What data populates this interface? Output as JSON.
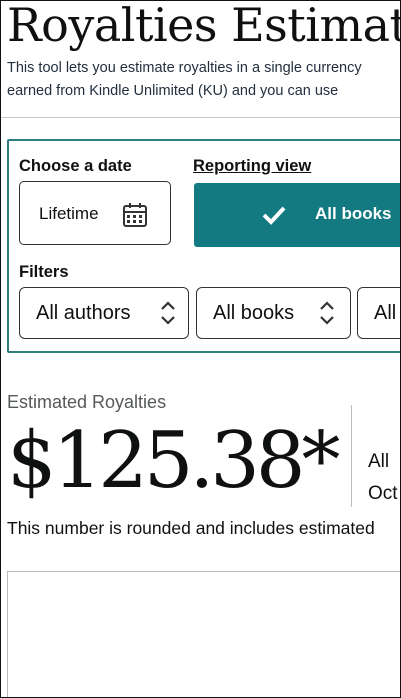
{
  "page": {
    "title": "Royalties Estimator",
    "intro_line1": "This tool lets you estimate royalties in a single currency",
    "intro_line2": "earned from Kindle Unlimited (KU) and you can use"
  },
  "controls": {
    "date_label": "Choose a date",
    "date_value": "Lifetime",
    "view_label": "Reporting view",
    "view_button": "All books",
    "filters_label": "Filters",
    "filter_authors": "All authors",
    "filter_books": "All books",
    "filter_third": "All"
  },
  "summary": {
    "label": "Estimated Royalties",
    "amount": "$125.38*",
    "side_line1": "All",
    "side_line2": "Oct",
    "note": "This number is rounded and includes estimated"
  },
  "colors": {
    "accent": "#137a82",
    "panel_border": "#2e7d80"
  },
  "icons": {
    "calendar": "calendar-icon",
    "check": "check-icon",
    "sort": "up-down-chevron-icon"
  }
}
